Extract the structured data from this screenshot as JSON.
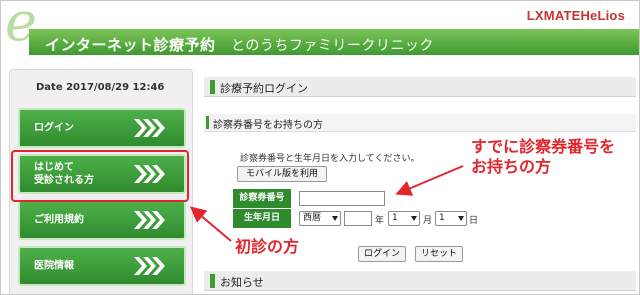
{
  "header": {
    "logo_letter": "e",
    "brand": "LXMATEHeLios",
    "site_title": "インターネット診療予約",
    "clinic_name": "とのうちファミリークリニック"
  },
  "sidebar": {
    "date": "Date 2017/08/29 12:46",
    "items": [
      {
        "label": "ログイン"
      },
      {
        "label": "はじめて\n受診される方"
      },
      {
        "label": "ご利用規約"
      },
      {
        "label": "医院情報"
      }
    ]
  },
  "main": {
    "section_title": "診療予約ログイン",
    "subsection_title": "診察券番号をお持ちの方",
    "instruction": "診察券番号と生年月日を入力してください。",
    "mobile_button": "モバイル版を利用",
    "form": {
      "card_number_label": "診察券番号",
      "card_number_value": "",
      "birthdate_label": "生年月日",
      "era_value": "西暦",
      "year_value": "",
      "year_unit": "年",
      "month_value": "1",
      "month_unit": "月",
      "day_value": "1",
      "day_unit": "日"
    },
    "login_button": "ログイン",
    "reset_button": "リセット",
    "news_title": "お知らせ"
  },
  "annotations": {
    "card_holder": "すでに診察券番号を\nお持ちの方",
    "first_visit": "初診の方"
  },
  "colors": {
    "brand_green": "#3f9a2f",
    "annotation_red": "#e3262d",
    "brand_text_red": "#c7342f"
  }
}
